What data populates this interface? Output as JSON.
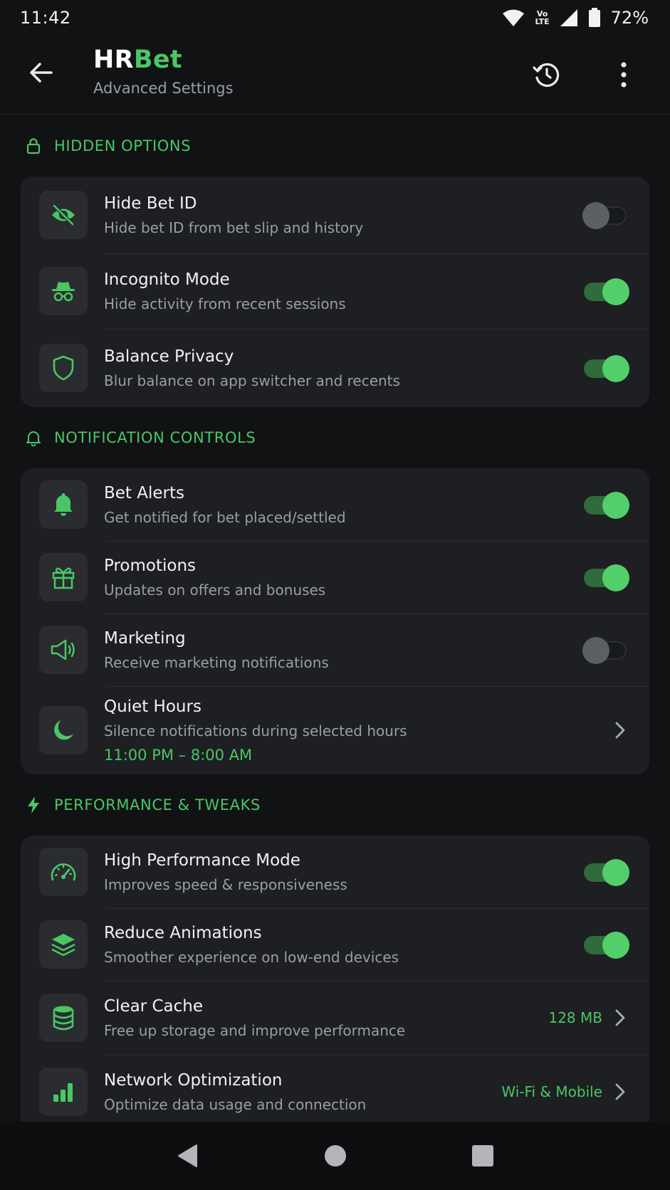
{
  "status_bar": {
    "time": "11:42",
    "network_badge_top": "Vo",
    "network_badge_bottom": "LTE",
    "battery": "72%"
  },
  "app_bar": {
    "title_main": "HR",
    "title_accent": "Bet",
    "subtitle": "Advanced Settings"
  },
  "colors": {
    "accent": "#49c765",
    "background": "#111214",
    "card": "#1d1f22",
    "toggle_on": "#52cf6b",
    "toggle_off": "#5c5f63"
  },
  "sections": [
    {
      "title": "HIDDEN OPTIONS",
      "icon": "lock-icon",
      "items": [
        {
          "title": "Hide Bet ID",
          "desc": "Hide bet ID from bet slip and history",
          "icon": "eye-off-icon",
          "toggle": false
        },
        {
          "title": "Incognito Mode",
          "desc": "Hide activity from recent sessions",
          "icon": "incognito-icon",
          "toggle": true
        },
        {
          "title": "Balance Privacy",
          "desc": "Blur balance on app switcher and recents",
          "icon": "shield-icon",
          "toggle": true
        }
      ]
    },
    {
      "title": "NOTIFICATION CONTROLS",
      "icon": "bell-outline-icon",
      "items": [
        {
          "title": "Bet Alerts",
          "desc": "Get notified for bet placed/settled",
          "icon": "bell-icon",
          "toggle": true
        },
        {
          "title": "Promotions",
          "desc": "Updates on offers and bonuses",
          "icon": "gift-icon",
          "toggle": true
        },
        {
          "title": "Marketing",
          "desc": "Receive marketing notifications",
          "icon": "megaphone-icon",
          "toggle": false
        },
        {
          "title": "Quiet Hours",
          "desc": "Silence notifications during selected hours",
          "extra": "11:00 PM – 8:00 AM",
          "icon": "moon-icon"
        }
      ]
    },
    {
      "title": "PERFORMANCE & TWEAKS",
      "icon": "lightning-icon",
      "items": [
        {
          "title": "High Performance Mode",
          "desc": "Improves speed & responsiveness",
          "icon": "speedometer-icon",
          "toggle": true
        },
        {
          "title": "Reduce Animations",
          "desc": "Smoother experience on low-end devices",
          "icon": "layers-icon",
          "toggle": true
        },
        {
          "title": "Clear Cache",
          "desc": "Free up storage and improve performance",
          "icon": "database-icon",
          "value": "128 MB"
        },
        {
          "title": "Network Optimization",
          "desc": "Optimize data usage and connection",
          "icon": "bar-chart-icon",
          "value": "Wi-Fi & Mobile"
        }
      ]
    }
  ]
}
